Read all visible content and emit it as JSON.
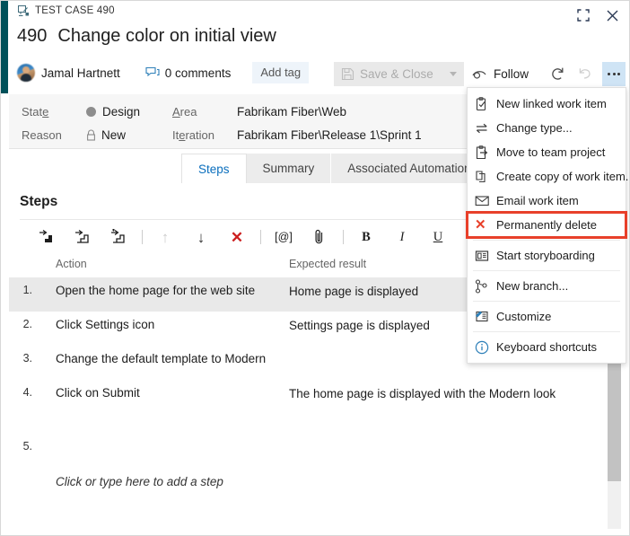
{
  "window": {
    "breadcrumb": "TEST CASE 490",
    "breadcrumb_icon": "test-case-icon",
    "maximize_icon": "maximize-icon",
    "close_icon": "close-icon"
  },
  "header": {
    "work_item_id": "490",
    "title": "Change color on initial view",
    "assignee": "Jamal Hartnett",
    "avatar_icon": "avatar",
    "comments_icon": "comment-icon",
    "comments_label": "0 comments",
    "add_tag_label": "Add tag",
    "save_close_label": "Save & Close",
    "save_close_icon": "save-disk-icon",
    "save_close_caret_icon": "chevron-down-icon",
    "follow_label": "Follow",
    "follow_icon": "eye-icon",
    "refresh_icon": "refresh-icon",
    "undo_icon": "undo-icon",
    "more_icon": "more-ellipsis-icon",
    "accent_color": "#00515a"
  },
  "fields": {
    "state_label": "State",
    "state_value": "Design",
    "state_dot_color": "#8d8d8d",
    "reason_label": "Reason",
    "reason_value": "New",
    "reason_icon": "lock-icon",
    "area_label": "Area",
    "area_value": "Fabrikam Fiber\\Web",
    "iteration_label": "Iteration",
    "iteration_value": "Fabrikam Fiber\\Release 1\\Sprint 1"
  },
  "tabs": [
    {
      "label": "Steps",
      "active": true
    },
    {
      "label": "Summary",
      "active": false
    },
    {
      "label": "Associated Automation",
      "active": false
    }
  ],
  "steps_section": {
    "heading": "Steps",
    "toolbar": [
      {
        "name": "insert-step-icon",
        "glyph": "step",
        "type": "icon",
        "disabled": false
      },
      {
        "name": "insert-shared-step-icon",
        "glyph": "step-shared",
        "type": "icon",
        "disabled": false
      },
      {
        "name": "add-step-icon",
        "glyph": "step-add",
        "type": "icon",
        "disabled": false
      },
      {
        "name": "separator-1",
        "glyph": "|",
        "type": "sep"
      },
      {
        "name": "move-up-icon",
        "glyph": "↑",
        "type": "arrow-up",
        "disabled": true
      },
      {
        "name": "move-down-icon",
        "glyph": "↓",
        "type": "arrow-down",
        "disabled": false
      },
      {
        "name": "delete-step-icon",
        "glyph": "✕",
        "type": "x",
        "disabled": false
      },
      {
        "name": "separator-2",
        "glyph": "|",
        "type": "sep"
      },
      {
        "name": "insert-parameter-icon",
        "glyph": "[@]",
        "type": "text",
        "disabled": false
      },
      {
        "name": "attach-file-icon",
        "glyph": "paperclip",
        "type": "icon",
        "disabled": false
      },
      {
        "name": "separator-3",
        "glyph": "|",
        "type": "sep"
      },
      {
        "name": "bold-button",
        "glyph": "B",
        "type": "bold",
        "disabled": false
      },
      {
        "name": "italic-button",
        "glyph": "I",
        "type": "italic",
        "disabled": false
      },
      {
        "name": "underline-button",
        "glyph": "U",
        "type": "underline",
        "disabled": false
      }
    ],
    "columns": {
      "num": "",
      "action": "Action",
      "expected": "Expected result"
    },
    "rows": [
      {
        "num": "1.",
        "action": "Open the home page for the web site",
        "expected": "Home page is displayed",
        "selected": true
      },
      {
        "num": "2.",
        "action": "Click Settings icon",
        "expected": "Settings page is displayed",
        "selected": false
      },
      {
        "num": "3.",
        "action": "Change the default template to Modern",
        "expected": "",
        "selected": false
      },
      {
        "num": "4.",
        "action": "Click on Submit",
        "expected": "The home page is displayed with the Modern look",
        "selected": false
      },
      {
        "num": "5.",
        "action": "",
        "expected": "",
        "selected": false
      }
    ],
    "add_step_hint": "Click or type here to add a step"
  },
  "context_menu": {
    "highlight_color": "#e8402a",
    "items": [
      {
        "label": "New linked work item",
        "icon": "new-linked-work-item-icon",
        "divider_after": false,
        "highlighted": false
      },
      {
        "label": "Change type...",
        "icon": "change-type-icon",
        "divider_after": false,
        "highlighted": false
      },
      {
        "label": "Move to team project",
        "icon": "move-to-project-icon",
        "divider_after": false,
        "highlighted": false
      },
      {
        "label": "Create copy of work item...",
        "icon": "copy-work-item-icon",
        "divider_after": false,
        "highlighted": false
      },
      {
        "label": "Email work item",
        "icon": "email-icon",
        "divider_after": false,
        "highlighted": false
      },
      {
        "label": "Permanently delete",
        "icon": "delete-x-icon",
        "divider_after": true,
        "highlighted": true
      },
      {
        "label": "Start storyboarding",
        "icon": "storyboard-icon",
        "divider_after": true,
        "highlighted": false
      },
      {
        "label": "New branch...",
        "icon": "branch-icon",
        "divider_after": true,
        "highlighted": false
      },
      {
        "label": "Customize",
        "icon": "customize-icon",
        "divider_after": true,
        "highlighted": false
      },
      {
        "label": "Keyboard shortcuts",
        "icon": "info-icon",
        "divider_after": false,
        "highlighted": false
      }
    ]
  },
  "scrollbar": {
    "name": "vertical-scrollbar"
  }
}
